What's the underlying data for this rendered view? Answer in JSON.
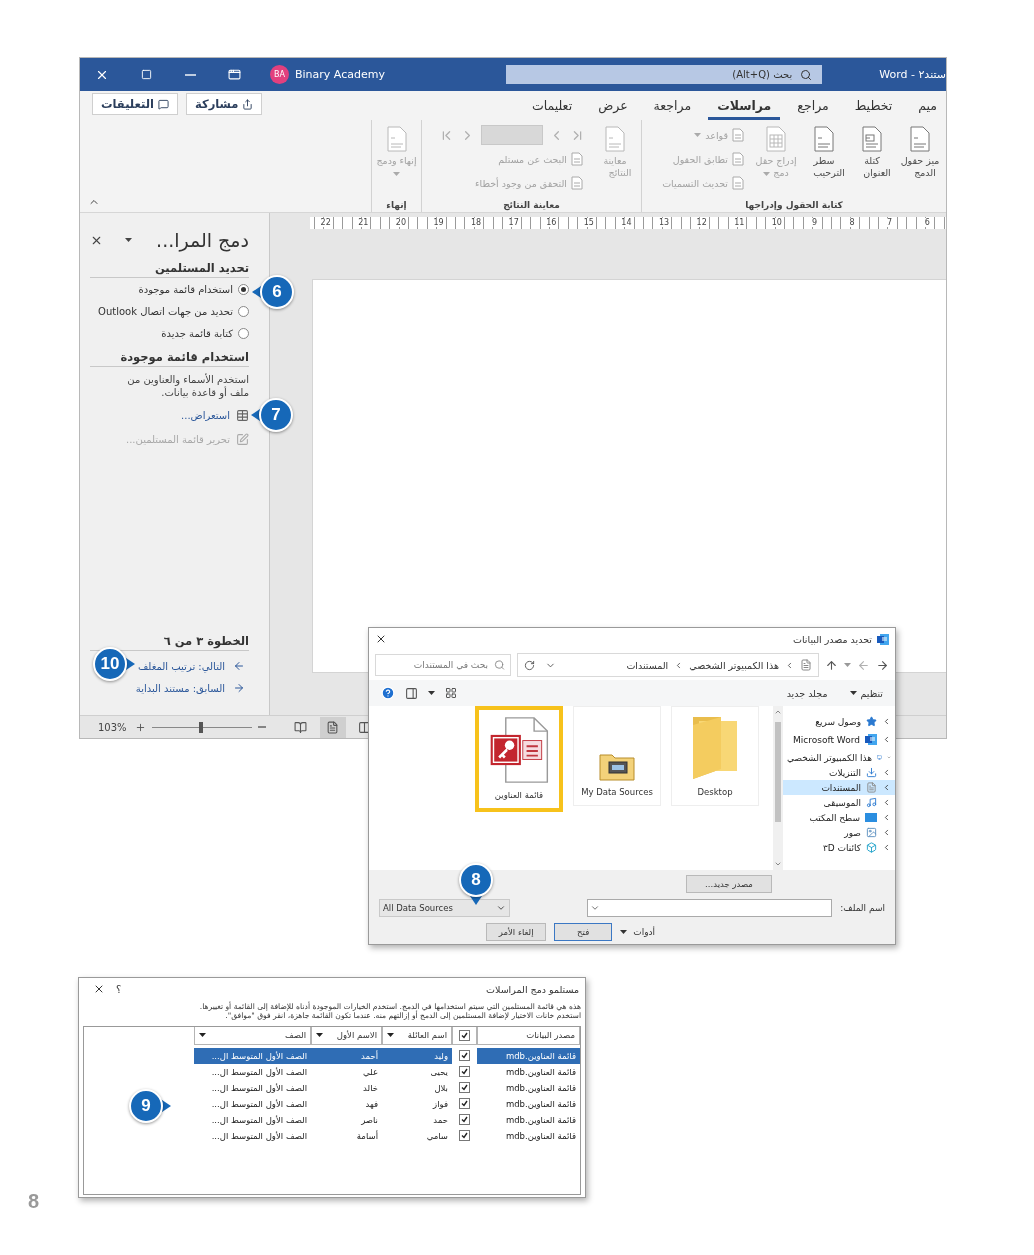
{
  "word_window": {
    "title": "ستند٢ - Word",
    "account": {
      "initials": "BA",
      "name": "Binary Academy"
    },
    "search": {
      "placeholder": "بحث (Alt+Q)"
    },
    "ribbon_tabs": [
      {
        "label": "ميم",
        "selected": false
      },
      {
        "label": "تخطيط",
        "selected": false
      },
      {
        "label": "مراجع",
        "selected": false
      },
      {
        "label": "مراسلات",
        "selected": true
      },
      {
        "label": "مراجعة",
        "selected": false
      },
      {
        "label": "عرض",
        "selected": false
      },
      {
        "label": "تعليمات",
        "selected": false
      }
    ],
    "share_button": "مشاركة",
    "comments_button": "التعليقات",
    "ribbon_groups": [
      {
        "label": "كتابة الحقول وإدراجها",
        "buttons": [
          {
            "kind": "large",
            "label": "ميز حقول الدمج",
            "disabled": false,
            "dropdown": false
          },
          {
            "kind": "large",
            "label": "كتلة العنوان",
            "disabled": false,
            "dropdown": false
          },
          {
            "kind": "large",
            "label": "سطر الترحيب",
            "disabled": false,
            "dropdown": false
          },
          {
            "kind": "large",
            "label": "إدراج حقل دمج",
            "disabled": true,
            "dropdown": true
          },
          {
            "kind": "small",
            "label": "قواعد",
            "disabled": true,
            "dropdown": true
          },
          {
            "kind": "small",
            "label": "تطابق الحقول",
            "disabled": true,
            "dropdown": false
          },
          {
            "kind": "small",
            "label": "تحديث التسميات",
            "disabled": true,
            "dropdown": false
          }
        ]
      },
      {
        "label": "معاينة النتائج",
        "buttons": [
          {
            "kind": "large",
            "label": "معاينة النتائج",
            "disabled": true,
            "dropdown": false
          },
          {
            "kind": "nav",
            "disabled": true
          },
          {
            "kind": "small",
            "label": "البحث عن مستلم",
            "disabled": true,
            "dropdown": false
          },
          {
            "kind": "small",
            "label": "التحقق من وجود أخطاء",
            "disabled": true,
            "dropdown": false
          }
        ]
      },
      {
        "label": "إنهاء",
        "buttons": [
          {
            "kind": "large",
            "label": "إنهاء ودمج",
            "disabled": true,
            "dropdown": true
          }
        ]
      }
    ],
    "ruler_marks": [
      "6",
      "7",
      "8",
      "9",
      "10",
      "11",
      "12",
      "13",
      "14",
      "15",
      "16",
      "17",
      "18",
      "19",
      "20",
      "21",
      "22"
    ],
    "task_pane": {
      "title": "دمج المرا...",
      "recipients_heading": "تحديد المستلمين",
      "recipient_options": [
        {
          "label": "استخدام قائمة موجودة",
          "selected": true
        },
        {
          "label": "تحديد من جهات اتصال Outlook",
          "selected": false
        },
        {
          "label": "كتابة قائمة جديدة",
          "selected": false
        }
      ],
      "list_heading": "استخدام قائمة موجودة",
      "list_description": "استخدم الأسماء والعناوين من ملف أو قاعدة بيانات.",
      "actions": [
        {
          "label": "استعراض...",
          "disabled": false
        },
        {
          "label": "تحرير قائمة المستلمين...",
          "disabled": true
        }
      ],
      "step_heading": "الخطوة ٣ من ٦",
      "steps": [
        {
          "kind": "next",
          "label": "التالي: ترتيب المغلف"
        },
        {
          "kind": "previous",
          "label": "السابق: مستند البداية"
        }
      ]
    },
    "status_bar": {
      "zoom": {
        "reading": "103%"
      },
      "views": [
        {
          "kind": "focus",
          "selected": false
        },
        {
          "kind": "print",
          "selected": true
        },
        {
          "kind": "web",
          "selected": false
        }
      ]
    }
  },
  "select_source_dialog": {
    "title": "تحديد مصدر البيانات",
    "path": [
      "هذا الكمبيوتر الشخصي",
      "المستندات"
    ],
    "search": {
      "placeholder": "بحث في المستندات"
    },
    "organize_button": "تنظيم",
    "new_folder_button": "مجلد جديد",
    "nav_items": [
      {
        "kind": "quick-access",
        "label": "وصول سريع",
        "selected": false,
        "expanded": false
      },
      {
        "kind": "app",
        "label": "Microsoft Word",
        "selected": false,
        "expanded": false
      },
      {
        "kind": "pc",
        "label": "هذا الكمبيوتر الشخصي",
        "selected": false,
        "expanded": true
      },
      {
        "kind": "downloads",
        "label": "التنزيلات",
        "selected": false,
        "expanded": false
      },
      {
        "kind": "documents",
        "label": "المستندات",
        "selected": true,
        "expanded": false
      },
      {
        "kind": "music",
        "label": "الموسيقى",
        "selected": false,
        "expanded": false
      },
      {
        "kind": "desktop",
        "label": "سطح المكتب",
        "selected": false,
        "expanded": false
      },
      {
        "kind": "pictures",
        "label": "صور",
        "selected": false,
        "expanded": false
      },
      {
        "kind": "objects",
        "label": "كائنات ٣D",
        "selected": false,
        "expanded": false
      }
    ],
    "files": [
      {
        "kind": "folder",
        "name": "Desktop",
        "selected": false
      },
      {
        "kind": "data-folder",
        "name": "My Data Sources",
        "selected": false
      },
      {
        "kind": "database",
        "name": "قائمة العناوين",
        "selected": true
      }
    ],
    "new_source_button": "مصدر جديد...",
    "filename_label": "اسم الملف:",
    "filter": "All Data Sources",
    "tools_button": "أدوات",
    "open_button": "فتح",
    "cancel_button": "إلغاء الأمر"
  },
  "recipients_dialog": {
    "title": "مستلمو دمج المراسلات",
    "help_button": "؟",
    "description": [
      "هذه هي قائمة المستلمين التي سيتم استخدامها في الدمج. استخدم الخيارات الموجودة أدناه للإضافة إلى القائمة أو تغييرها.",
      "استخدم خانات الاختيار لإضافة المستلمين إلى الدمج أو إزالتهم منه. عندما تكون القائمة جاهزة، انقر فوق \"موافق\"."
    ],
    "columns": [
      {
        "kind": "text",
        "label": "مصدر البيانات"
      },
      {
        "kind": "check",
        "checked": true
      },
      {
        "kind": "filter",
        "label": "اسم العائلة"
      },
      {
        "kind": "filter",
        "label": "الاسم الأول"
      },
      {
        "kind": "filter",
        "label": "الصف"
      }
    ],
    "rows": [
      {
        "source": "قائمة العناوين.mdb",
        "included": true,
        "last_name": "وليد",
        "first_name": "أحمد",
        "class": "الصف الأول المتوسط ال...",
        "selected": true
      },
      {
        "source": "قائمة العناوين.mdb",
        "included": true,
        "last_name": "يحيى",
        "first_name": "علي",
        "class": "الصف الأول المتوسط ال...",
        "selected": false
      },
      {
        "source": "قائمة العناوين.mdb",
        "included": true,
        "last_name": "بلال",
        "first_name": "خالد",
        "class": "الصف الأول المتوسط ال...",
        "selected": false
      },
      {
        "source": "قائمة العناوين.mdb",
        "included": true,
        "last_name": "فواز",
        "first_name": "فهد",
        "class": "الصف الأول المتوسط ال...",
        "selected": false
      },
      {
        "source": "قائمة العناوين.mdb",
        "included": true,
        "last_name": "حمد",
        "first_name": "ناصر",
        "class": "الصف الأول المتوسط ال...",
        "selected": false
      },
      {
        "source": "قائمة العناوين.mdb",
        "included": true,
        "last_name": "سامي",
        "first_name": "أسامة",
        "class": "الصف الأول المتوسط ال...",
        "selected": false
      }
    ]
  },
  "callouts": [
    {
      "label": "6"
    },
    {
      "label": "7"
    },
    {
      "label": "10"
    },
    {
      "label": "8"
    },
    {
      "label": "9"
    }
  ],
  "page_number": "8"
}
